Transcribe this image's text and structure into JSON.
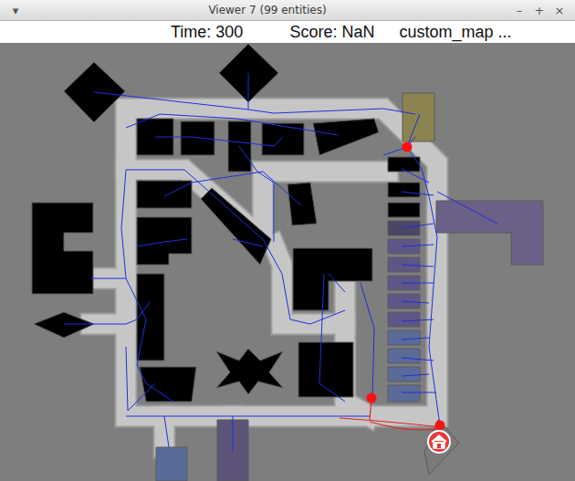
{
  "window": {
    "title": "Viewer 7 (99 entities)",
    "menu_icon": "▾",
    "controls": [
      "–",
      "+",
      "×"
    ]
  },
  "status_bar": [
    "Time: 300",
    "Score: NaN",
    "custom_map ..."
  ],
  "map": {
    "buildings": [
      {
        "color": "#000000"
      },
      {
        "color": "#000000"
      },
      {
        "color": "#000000"
      },
      {
        "color": "#000000"
      },
      {
        "color": "#000000"
      },
      {
        "color": "#000000"
      },
      {
        "color": "#000000"
      },
      {
        "color": "#000000"
      },
      {
        "color": "#000000"
      },
      {
        "color": "#000000"
      },
      {
        "color": "#000000"
      },
      {
        "color": "#000000"
      },
      {
        "color": "#000000"
      },
      {
        "color": "#000000"
      },
      {
        "color": "#000000"
      },
      {
        "color": "#000000"
      },
      {
        "color": "#000000"
      },
      {
        "color": "#000000"
      },
      {
        "color": "#000000"
      },
      {
        "color": "#000000"
      },
      {
        "color": "#000000"
      },
      {
        "color": "#4b4566"
      },
      {
        "color": "#5e5685"
      },
      {
        "color": "#5e5685"
      },
      {
        "color": "#5e5685"
      },
      {
        "color": "#5e5685"
      },
      {
        "color": "#5e5685"
      },
      {
        "color": "#5b6b98"
      },
      {
        "color": "#5b6b98"
      },
      {
        "color": "#5b6b98"
      },
      {
        "color": "#5b6b98"
      },
      {
        "color": "#8c8450"
      },
      {
        "color": "#6b6088"
      },
      {
        "color": "#5a6a96"
      },
      {
        "color": "#5e5478"
      },
      {
        "color": "#7a7a7a"
      }
    ]
  }
}
